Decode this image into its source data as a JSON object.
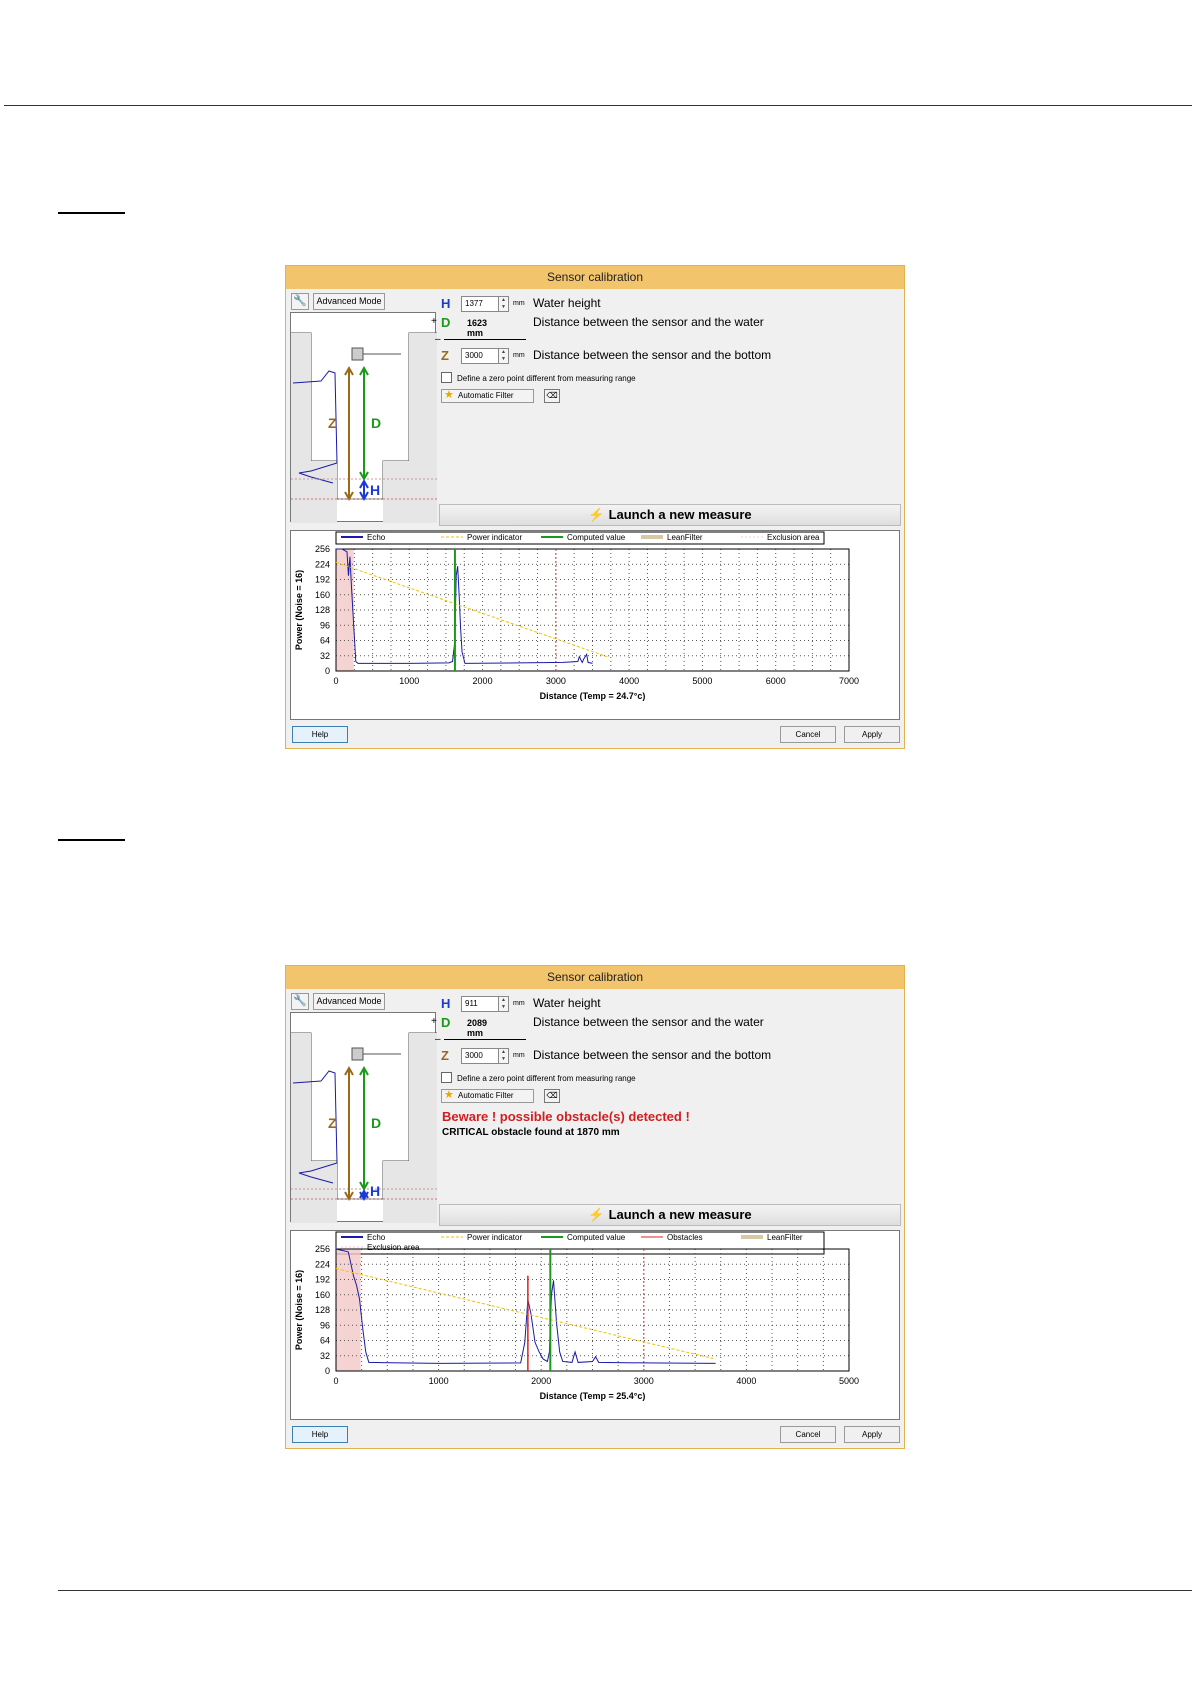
{
  "colors": {
    "title_bar": "#f2c46c",
    "echo": "#1a1aa8",
    "power_indicator": "#f0c000",
    "computed_value": "#1a9a1a",
    "obstacles": "#e02020",
    "lean_filter": "#d8c9a6",
    "exclusion_area": "#f4c8c8",
    "letter_h": "#1a3ad8",
    "letter_d": "#1a9a1a",
    "letter_z": "#9a6a1a",
    "warning": "#d11f1f"
  },
  "icons": {
    "advanced": "wrench-icon",
    "filter": "star-icon",
    "clear": "clear-filter-icon",
    "launch": "lightning-icon"
  },
  "windows": [
    {
      "title": "Sensor calibration",
      "advanced_mode_label": "Advanced Mode",
      "params": {
        "h": {
          "letter": "H",
          "value": "1377",
          "unit": "mm",
          "desc": "Water height"
        },
        "d": {
          "letter": "D",
          "value": "1623 mm",
          "desc": "Distance between the sensor and the water"
        },
        "z": {
          "letter": "Z",
          "value": "3000",
          "unit": "mm",
          "desc": "Distance between the sensor and the bottom"
        }
      },
      "plus_sign": "+",
      "minus_sign": "–",
      "zero_point_label": "Define a zero point different from measuring range",
      "filter_label": "Automatic Filter",
      "clear_label": "⌫",
      "launch_label": "Launch a new measure",
      "diagram_labels": {
        "z": "Z",
        "d": "D",
        "h": "H"
      },
      "buttons": {
        "help": "Help",
        "cancel": "Cancel",
        "apply": "Apply"
      },
      "chart_data": {
        "type": "line",
        "xlabel": "Distance (Temp = 24.7°c)",
        "ylabel": "Power (Noise = 16)",
        "xlim": [
          0,
          7000
        ],
        "ylim": [
          0,
          256
        ],
        "xticks": [
          0,
          1000,
          2000,
          3000,
          4000,
          5000,
          6000,
          7000
        ],
        "yticks": [
          0,
          32,
          64,
          96,
          128,
          160,
          192,
          224,
          256
        ],
        "grid": true,
        "legend_position": "top",
        "legend": [
          "Echo",
          "Power indicator",
          "Computed value",
          "LeanFilter",
          "Exclusion area"
        ],
        "series": [
          {
            "name": "Echo",
            "x": [
              0,
              80,
              150,
              170,
              190,
              210,
              240,
              270,
              300,
              1000,
              1540,
              1590,
              1620,
              1640,
              1660,
              1680,
              1700,
              1720,
              1760,
              2500,
              3100,
              3300,
              3320,
              3360,
              3380,
              3420,
              3440,
              3500
            ],
            "y": [
              256,
              256,
              250,
              200,
              240,
              180,
              100,
              20,
              16,
              16,
              17,
              20,
              60,
              200,
              220,
              160,
              90,
              40,
              16,
              17,
              18,
              20,
              30,
              18,
              25,
              35,
              18,
              16
            ]
          },
          {
            "name": "Power indicator",
            "x": [
              0,
              3700
            ],
            "y": [
              228,
              30
            ]
          },
          {
            "name": "Computed value",
            "x": [
              1623,
              1623
            ],
            "y": [
              0,
              256
            ]
          },
          {
            "name": "Exclusion area",
            "x": [
              0,
              240
            ],
            "y": [
              256,
              256
            ]
          }
        ],
        "markers": {
          "lean_filter_x": 3000
        }
      }
    },
    {
      "title": "Sensor calibration",
      "advanced_mode_label": "Advanced Mode",
      "params": {
        "h": {
          "letter": "H",
          "value": "911",
          "unit": "mm",
          "desc": "Water height"
        },
        "d": {
          "letter": "D",
          "value": "2089 mm",
          "desc": "Distance between the sensor and the water"
        },
        "z": {
          "letter": "Z",
          "value": "3000",
          "unit": "mm",
          "desc": "Distance between the sensor and the bottom"
        }
      },
      "plus_sign": "+",
      "minus_sign": "–",
      "zero_point_label": "Define a zero point different from measuring range",
      "filter_label": "Automatic Filter",
      "clear_label": "⌫",
      "warning_title": "Beware ! possible obstacle(s) detected !",
      "warning_detail": "CRITICAL obstacle found at 1870 mm",
      "launch_label": "Launch a new measure",
      "diagram_labels": {
        "z": "Z",
        "d": "D",
        "h": "H"
      },
      "buttons": {
        "help": "Help",
        "cancel": "Cancel",
        "apply": "Apply"
      },
      "chart_data": {
        "type": "line",
        "xlabel": "Distance (Temp = 25.4°c)",
        "ylabel": "Power (Noise = 16)",
        "xlim": [
          0,
          5000
        ],
        "ylim": [
          0,
          256
        ],
        "xticks": [
          0,
          1000,
          2000,
          3000,
          4000,
          5000
        ],
        "yticks": [
          0,
          32,
          64,
          96,
          128,
          160,
          192,
          224,
          256
        ],
        "grid": true,
        "legend_position": "top",
        "legend": [
          "Echo",
          "Power indicator",
          "Computed value",
          "Obstacles",
          "LeanFilter",
          "Exclusion area"
        ],
        "series": [
          {
            "name": "Echo",
            "x": [
              0,
              120,
              170,
              200,
              230,
              260,
              290,
              320,
              1000,
              1800,
              1840,
              1870,
              1900,
              1940,
              1980,
              2020,
              2060,
              2080,
              2100,
              2120,
              2150,
              2180,
              2210,
              2300,
              2330,
              2360,
              2500,
              2530,
              2560,
              3000,
              3700
            ],
            "y": [
              256,
              250,
              200,
              180,
              150,
              90,
              40,
              18,
              16,
              17,
              60,
              150,
              120,
              60,
              40,
              25,
              20,
              40,
              160,
              190,
              100,
              40,
              20,
              18,
              40,
              18,
              20,
              30,
              18,
              17,
              16
            ]
          },
          {
            "name": "Power indicator",
            "x": [
              0,
              3700
            ],
            "y": [
              215,
              25
            ]
          },
          {
            "name": "Computed value",
            "x": [
              2089,
              2089
            ],
            "y": [
              0,
              256
            ]
          },
          {
            "name": "Obstacles",
            "x": [
              1870,
              1870
            ],
            "y": [
              0,
              200
            ]
          },
          {
            "name": "Exclusion area",
            "x": [
              0,
              240
            ],
            "y": [
              256,
              256
            ]
          }
        ],
        "markers": {
          "lean_filter_x": 3000
        }
      }
    }
  ]
}
